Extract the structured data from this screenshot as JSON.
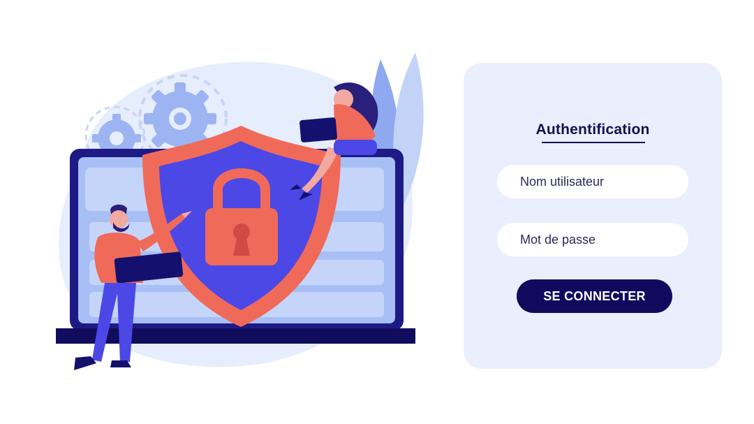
{
  "login": {
    "title": "Authentification",
    "username_placeholder": "Nom utilisateur",
    "password_placeholder": "Mot de passe",
    "submit_label": "SE CONNECTER"
  },
  "colors": {
    "card_background": "#e9effc",
    "primary_dark": "#0f0a5e",
    "shield_red": "#f06a5a",
    "shield_blue": "#4b48e6",
    "illustration_light": "#e6edfc"
  },
  "icons": {
    "illustration": "cybersecurity-shield-lock-illustration"
  }
}
